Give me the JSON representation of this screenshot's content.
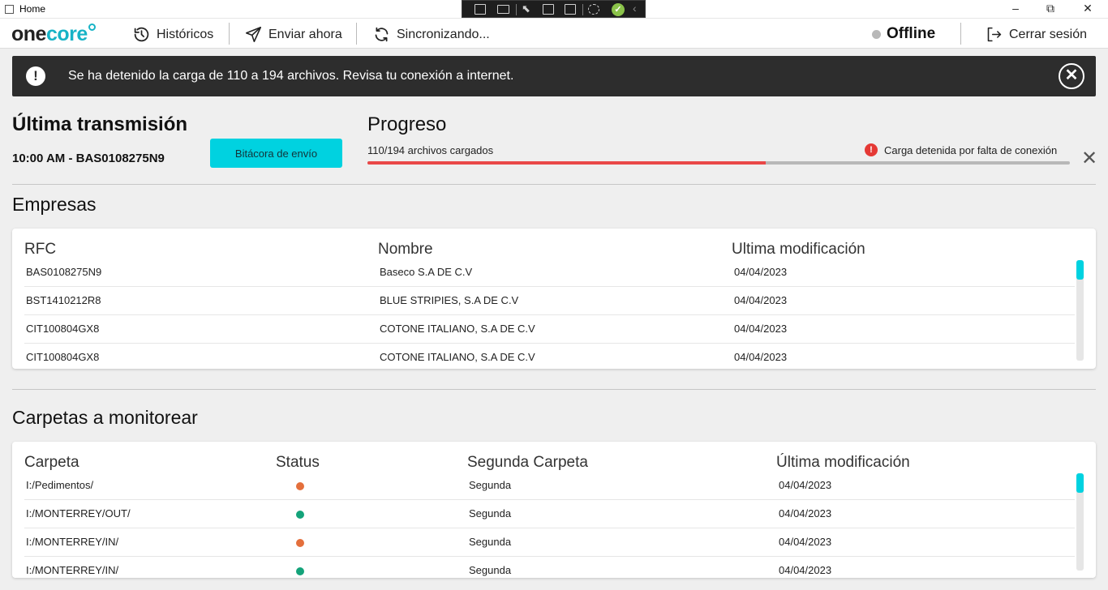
{
  "window": {
    "title": "Home",
    "minimize": "–",
    "maximize": "⧉",
    "close": "✕"
  },
  "nav": {
    "logo_one": "one",
    "logo_core": "core",
    "historicos": "Históricos",
    "enviar": "Enviar ahora",
    "sincronizando": "Sincronizando...",
    "status": "Offline",
    "logout": "Cerrar sesión"
  },
  "alert": {
    "icon": "!",
    "message": "Se ha detenido la carga de 110 a 194 archivos. Revisa tu conexión a internet.",
    "close": "✕"
  },
  "transmision": {
    "title": "Última transmisión",
    "detail": "10:00 AM - BAS0108275N9",
    "button": "Bitácora de envío"
  },
  "progreso": {
    "title": "Progreso",
    "label": "110/194 archivos cargados",
    "error_icon": "!",
    "error": "Carga detenida por falta de conexión",
    "loaded": 110,
    "total": 194,
    "close": "✕"
  },
  "empresas": {
    "title": "Empresas",
    "headers": [
      "RFC",
      "Nombre",
      "Ultima modificación"
    ],
    "rows": [
      {
        "rfc": "BAS0108275N9",
        "nombre": "Baseco S.A DE C.V",
        "fecha": "04/04/2023"
      },
      {
        "rfc": "BST1410212R8",
        "nombre": "BLUE STRIPIES, S.A DE C.V",
        "fecha": "04/04/2023"
      },
      {
        "rfc": "CIT100804GX8",
        "nombre": "COTONE ITALIANO, S.A DE C.V",
        "fecha": "04/04/2023"
      },
      {
        "rfc": "CIT100804GX8",
        "nombre": "COTONE ITALIANO, S.A DE C.V",
        "fecha": "04/04/2023"
      }
    ]
  },
  "carpetas": {
    "title": "Carpetas a monitorear",
    "headers": [
      "Carpeta",
      "Status",
      "Segunda Carpeta",
      "Última modificación"
    ],
    "rows": [
      {
        "carpeta": "I:/Pedimentos/",
        "status_color": "#e46f3c",
        "segunda": "Segunda",
        "fecha": "04/04/2023"
      },
      {
        "carpeta": "I:/MONTERREY/OUT/",
        "status_color": "#14a37a",
        "segunda": "Segunda",
        "fecha": "04/04/2023"
      },
      {
        "carpeta": "I:/MONTERREY/IN/",
        "status_color": "#e46f3c",
        "segunda": "Segunda",
        "fecha": "04/04/2023"
      },
      {
        "carpeta": "I:/MONTERREY/IN/",
        "status_color": "#14a37a",
        "segunda": "Segunda",
        "fecha": "04/04/2023"
      }
    ]
  },
  "colors": {
    "accent": "#00d2e0",
    "progress": "#e94848",
    "status_offline": "#b8b8b8",
    "alert_bg": "#2d2d2d",
    "dot_orange": "#e46f3c",
    "dot_green": "#14a37a"
  },
  "icons": {
    "historicos": "history-icon",
    "enviar": "send-icon",
    "sincronizando": "sync-icon",
    "logout": "logout-icon"
  }
}
